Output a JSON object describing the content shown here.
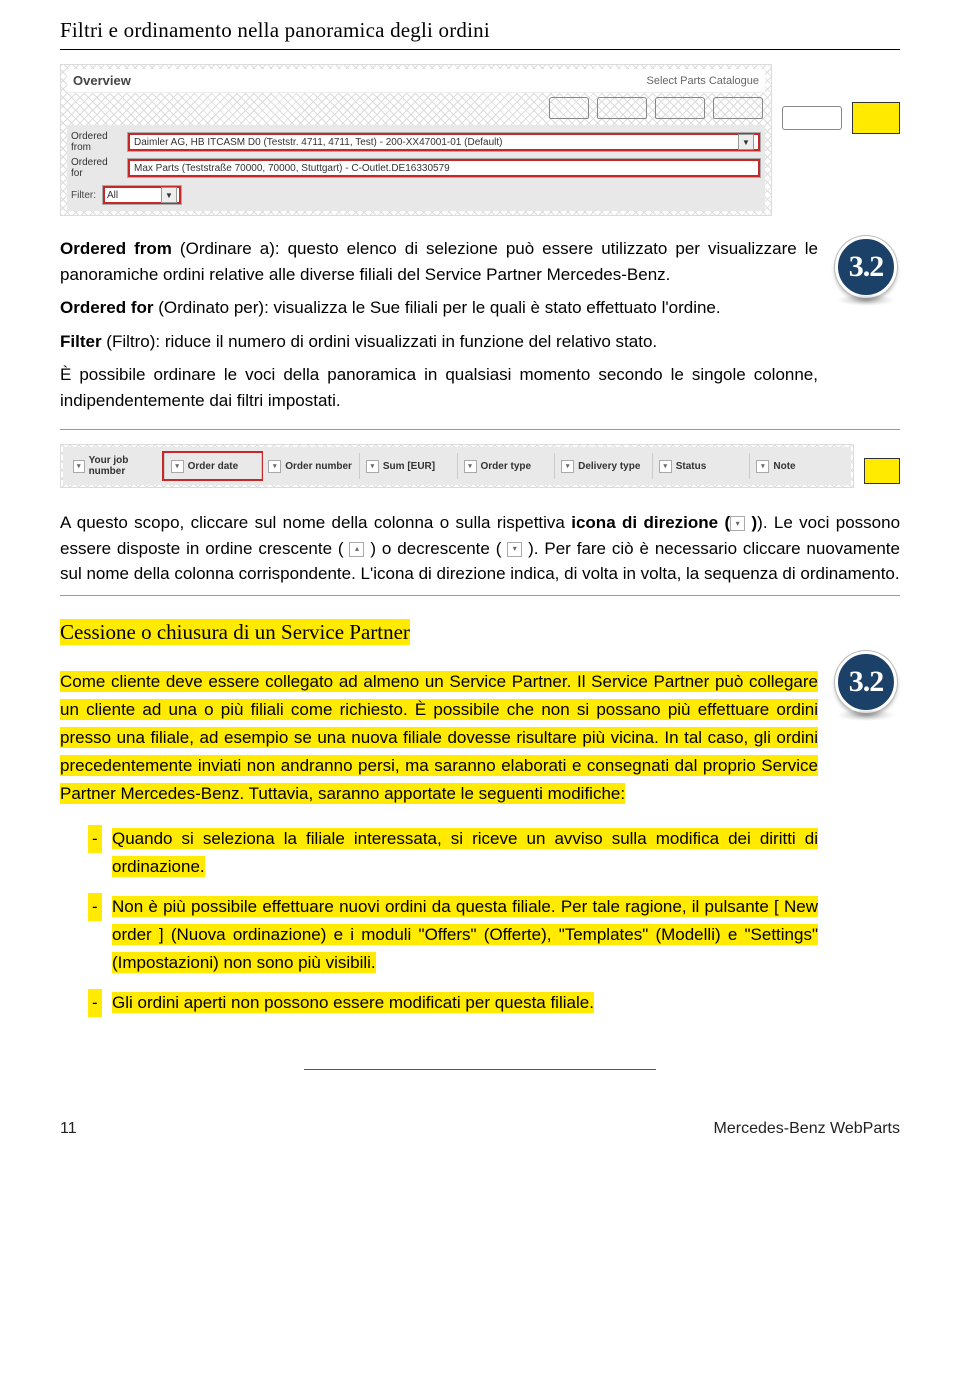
{
  "section_title": "Filtri e ordinamento nella panoramica degli ordini",
  "badge_text": "3.2",
  "overview": {
    "heading": "Overview",
    "select_catalogue": "Select Parts Catalogue",
    "ordered_from_label": "Ordered from",
    "ordered_from_value": "Daimler AG, HB ITCASM D0 (Teststr. 4711, 4711, Test) - 200-XX47001-01 (Default)",
    "ordered_for_label": "Ordered for",
    "ordered_for_value": "Max Parts (Teststraße 70000, 70000, Stuttgart) - C-Outlet.DE16330579",
    "filter_label": "Filter:",
    "filter_value": "All"
  },
  "para1_a": "Ordered from",
  "para1_b": " (Ordinare a): questo elenco di selezione può essere utilizzato per visualizzare le panoramiche ordini relative alle diverse filiali del Service Partner Mercedes-Benz.",
  "para2_a": "Ordered for",
  "para2_b": " (Ordinato per): visualizza le Sue filiali per le quali è stato effettuato l'ordine.",
  "para3_a": "Filter",
  "para3_b": " (Filtro): riduce il numero di ordini visualizzati in funzione del relativo stato.",
  "para4": "È possibile ordinare le voci della panoramica in qualsiasi momento secondo le singole colonne, indipendentemente dai filtri impostati.",
  "columns": [
    "Your job number",
    "Order date",
    "Order number",
    "Sum [EUR]",
    "Order type",
    "Delivery type",
    "Status",
    "Note"
  ],
  "para5_a": "A questo scopo, cliccare sul nome della colonna o sulla rispettiva ",
  "para5_b": "icona di direzione (",
  "para5_c": "). Le voci possono essere disposte in ordine crescente ( ",
  "para5_d": " ) o decrescente ( ",
  "para5_e": " ). Per fare ciò è necessario cliccare nuovamente sul nome della colonna corrispondente. L'icona di direzione indica, di volta in volta, la sequenza di ordinamento.",
  "section2_title": "Cessione o chiusura di un Service Partner",
  "para6": "Come cliente deve essere collegato ad almeno un Service Partner. Il Service Partner può collegare un cliente ad una o più filiali come richiesto. È possibile che non si possano più effettuare ordini presso una filiale, ad esempio se una nuova filiale dovesse risultare più vicina. In tal caso, gli ordini precedentemente inviati non andranno persi, ma saranno elaborati e consegnati dal proprio Service Partner Mercedes-Benz. Tuttavia, saranno apportate le seguenti modifiche:",
  "bullet1": "Quando si seleziona la filiale interessata, si riceve un avviso sulla modifica dei diritti di ordinazione.",
  "bullet2": "Non è più possibile effettuare nuovi ordini da questa filiale. Per tale ragione, il pulsante [ New order ] (Nuova ordinazione) e i moduli \"Offers\" (Offerte), \"Templates\" (Modelli) e \"Settings\" (Impostazioni) non sono più visibili.",
  "bullet3": "Gli ordini aperti non possono essere modificati per questa filiale.",
  "footer_page": "11",
  "footer_text": "Mercedes-Benz WebParts"
}
